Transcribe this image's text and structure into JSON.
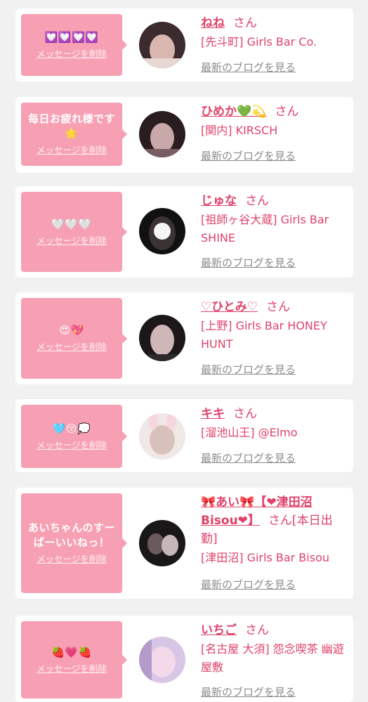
{
  "cards": [
    {
      "message": "💟💟💟💟",
      "delete_label": "メッセージを削除",
      "name": "ねね",
      "honorific": "さん",
      "shop": "[先斗町] Girls Bar Co.",
      "blog_link": "最新のブログを見る",
      "avatar_colors": [
        "#3b2a2e",
        "#d9b6b0",
        "#e8d7d3"
      ]
    },
    {
      "message": "毎日お疲れ様です🌟",
      "delete_label": "メッセージを削除",
      "name": "ひめか💚💫",
      "honorific": "さん",
      "shop": "[関内] KIRSCH",
      "blog_link": "最新のブログを見る",
      "avatar_colors": [
        "#2a1d1f",
        "#c9a8a9",
        "#7a5d62"
      ]
    },
    {
      "message": "🤍🤍🤍",
      "delete_label": "メッセージを削除",
      "name": "じゅな",
      "honorific": "さん",
      "shop": "[祖師ヶ谷大蔵] Girls Bar SHINE",
      "blog_link": "最新のブログを見る",
      "avatar_colors": [
        "#111111",
        "#3a3333",
        "#f5f5f5"
      ]
    },
    {
      "message": "😍💖",
      "delete_label": "メッセージを削除",
      "name": "♡ひとみ♡",
      "honorific": "さん",
      "shop": "[上野] Girls Bar HONEY HUNT",
      "blog_link": "最新のブログを見る",
      "avatar_colors": [
        "#1c1719",
        "#cfb6b8",
        "#2e2a2b"
      ]
    },
    {
      "message": "🩵😚💭",
      "delete_label": "メッセージを削除",
      "name": "キキ",
      "honorific": "さん",
      "shop": "[溜池山王] @Elmo",
      "blog_link": "最新のブログを見る",
      "avatar_colors": [
        "#efe8e6",
        "#d9c1bb",
        "#f6d7df"
      ]
    },
    {
      "message": "あいちゃんのすーぱーいいねっ！",
      "delete_label": "メッセージを削除",
      "name": "🎀あい🎀【❤津田沼Bisou❤】",
      "honorific": "さん[本日出勤]",
      "shop": "[津田沼] Girls Bar Bisou",
      "blog_link": "最新のブログを見る",
      "avatar_colors": [
        "#1a1718",
        "#6a5a5c",
        "#c7b6b7"
      ]
    },
    {
      "message": "🍓💗🍓",
      "delete_label": "メッセージを削除",
      "name": "いちご",
      "honorific": "さん",
      "shop": "[名古屋 大須] 怨念喫茶 幽遊屋敷",
      "blog_link": "最新のブログを見る",
      "avatar_colors": [
        "#d8c6e6",
        "#f3d9ea",
        "#b59bc9"
      ]
    }
  ]
}
